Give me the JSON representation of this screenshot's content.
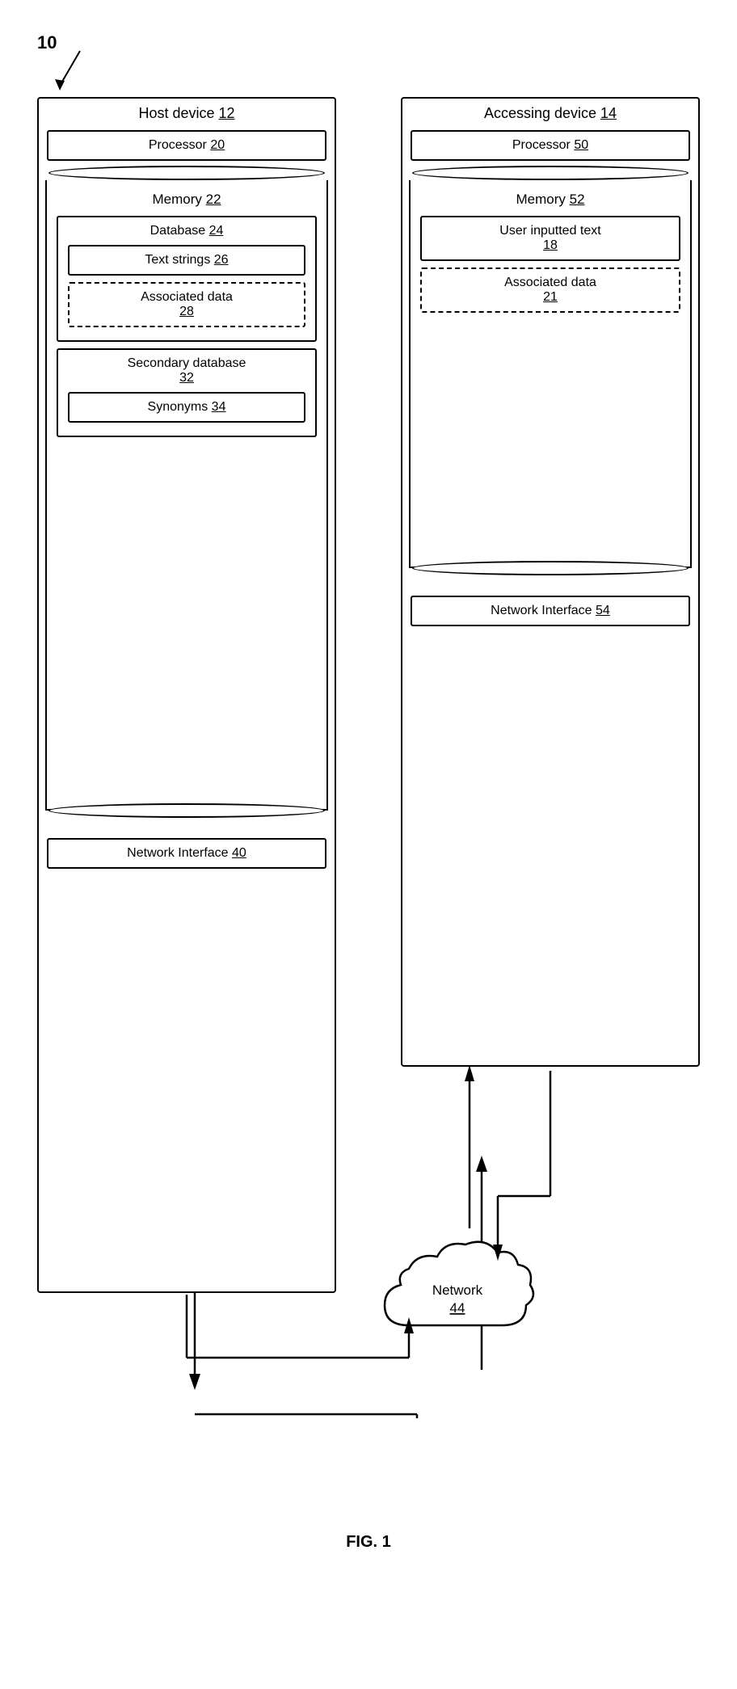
{
  "diagram": {
    "ref": "10",
    "fig_label": "FIG. 1",
    "host_device": {
      "title": "Host device",
      "title_num": "12",
      "processor_label": "Processor",
      "processor_num": "20",
      "memory_label": "Memory",
      "memory_num": "22",
      "database_label": "Database",
      "database_num": "24",
      "text_strings_label": "Text strings",
      "text_strings_num": "26",
      "associated_data_label": "Associated data",
      "associated_data_num": "28",
      "secondary_db_label": "Secondary database",
      "secondary_db_num": "32",
      "synonyms_label": "Synonyms",
      "synonyms_num": "34",
      "network_interface_label": "Network Interface",
      "network_interface_num": "40"
    },
    "accessing_device": {
      "title": "Accessing device",
      "title_num": "14",
      "processor_label": "Processor",
      "processor_num": "50",
      "memory_label": "Memory",
      "memory_num": "52",
      "user_input_label": "User inputted text",
      "user_input_num": "18",
      "associated_data_label": "Associated data",
      "associated_data_num": "21",
      "network_interface_label": "Network Interface",
      "network_interface_num": "54"
    },
    "network": {
      "label": "Network",
      "num": "44"
    }
  }
}
